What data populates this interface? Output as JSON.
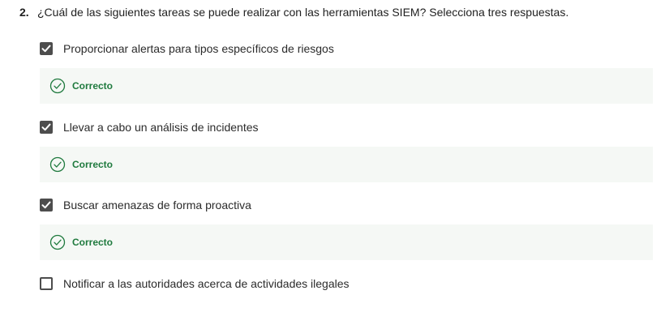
{
  "question": {
    "number": "2.",
    "text": "¿Cuál de las siguientes tareas se puede realizar con las herramientas SIEM? Selecciona tres respuestas."
  },
  "options": [
    {
      "label": "Proporcionar alertas para tipos específicos de riesgos",
      "checked": true,
      "feedback": "Correcto"
    },
    {
      "label": "Llevar a cabo un análisis de incidentes",
      "checked": true,
      "feedback": "Correcto"
    },
    {
      "label": "Buscar amenazas de forma proactiva",
      "checked": true,
      "feedback": "Correcto"
    },
    {
      "label": "Notificar a las autoridades acerca de actividades ilegales",
      "checked": false
    }
  ],
  "colors": {
    "checkbox": "#4d4d4d",
    "feedback_bg": "#f5f8f5",
    "correct": "#1f7a3e"
  },
  "icons": {
    "checkmark": "check-icon",
    "correct": "circle-check-icon"
  }
}
